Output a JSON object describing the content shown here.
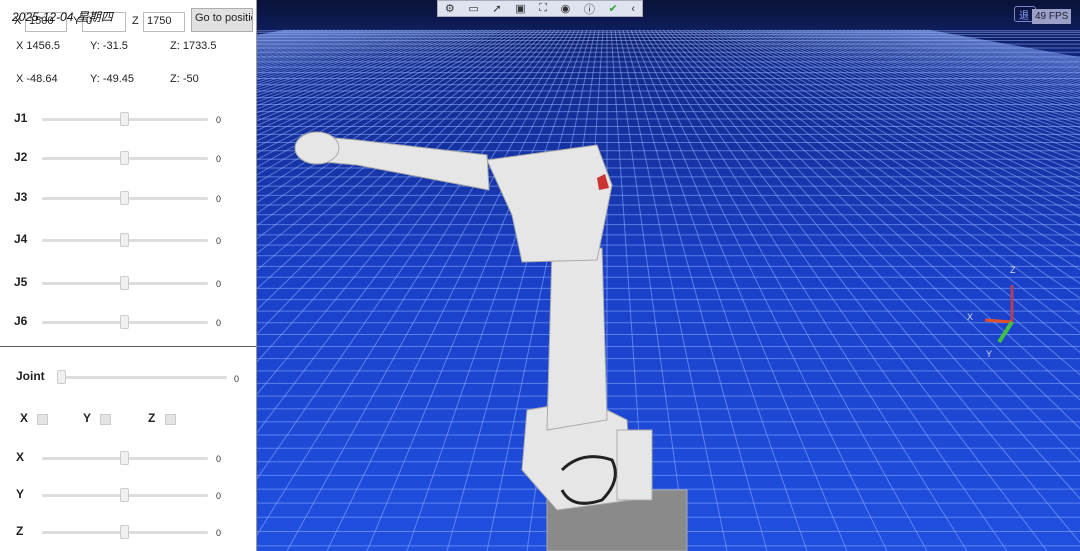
{
  "datetime": "2025-12-04 星期四",
  "target": {
    "x_label": "X",
    "x": "1500",
    "y_label": "Y",
    "y": "0",
    "z_label": "Z",
    "z": "1750",
    "go_button": "Go to position"
  },
  "position": {
    "x": "X  1456.5",
    "y": "Y:  -31.5",
    "z": "Z:  1733.5"
  },
  "orientation": {
    "x": "X  -48.64",
    "y": "Y:  -49.45",
    "z": "Z:  -50"
  },
  "joints": [
    {
      "label": "J1",
      "value": "0"
    },
    {
      "label": "J2",
      "value": "0"
    },
    {
      "label": "J3",
      "value": "0"
    },
    {
      "label": "J4",
      "value": "0"
    },
    {
      "label": "J5",
      "value": "0"
    },
    {
      "label": "J6",
      "value": "0"
    }
  ],
  "joint_selector": {
    "label": "Joint",
    "value": "0"
  },
  "axis_checks": [
    {
      "label": "X"
    },
    {
      "label": "Y"
    },
    {
      "label": "Z"
    }
  ],
  "offset_sliders": [
    {
      "label": "X",
      "value": "0"
    },
    {
      "label": "Y",
      "value": "0"
    },
    {
      "label": "Z",
      "value": "0"
    }
  ],
  "fps": "49 FPS",
  "exit_button": "退",
  "gizmo": {
    "x": "X",
    "y": "Y",
    "z": "Z"
  },
  "colors": {
    "floor": "#1c3fcf",
    "sky": "#0a1030",
    "robot": "#e8e8e8"
  }
}
